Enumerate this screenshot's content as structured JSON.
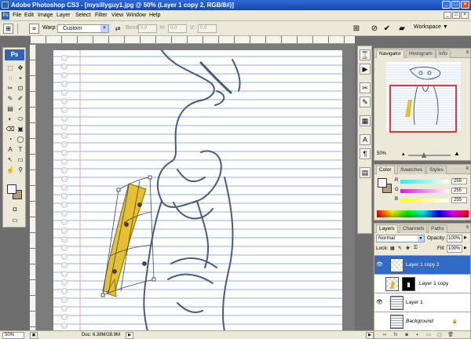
{
  "window": {
    "title": "Adobe Photoshop CS3 - [mysillyguy1.jpg @ 50% (Layer 1 copy 2, RGB/8#)]",
    "controls": [
      "_",
      "□",
      "×"
    ]
  },
  "menu": {
    "items": [
      "File",
      "Edit",
      "Image",
      "Layer",
      "Select",
      "Filter",
      "View",
      "Window",
      "Help"
    ],
    "doc_controls": [
      "_",
      "□",
      "×"
    ]
  },
  "options_bar": {
    "tool_icon": "transform-icon",
    "warp_label": "Warp:",
    "warp_value": "Custom",
    "bend_label": "Bend:",
    "bend_value": "0.0",
    "h_label": "H:",
    "h_value": "0.0",
    "v_label": "V:",
    "v_value": "0.0",
    "workspace_label": "Workspace ▼"
  },
  "toolbox": {
    "logo": "Ps",
    "tool_glyphs": [
      "⬚",
      "✥",
      "◌",
      "⌖",
      "✂",
      "⊡",
      "✎",
      "✐",
      "▤",
      "✓",
      "◐",
      "⬭",
      "⌫",
      "▣",
      "◔",
      "◯",
      "A",
      "T",
      "↖",
      "▭",
      "☝",
      "⚲"
    ],
    "fg_color": "#ffffff",
    "bg_color": "#b49a7a"
  },
  "navigator": {
    "tabs": [
      "Navigator",
      "Histogram",
      "Info"
    ],
    "zoom_value": "50%",
    "view_box_color": "#d83c3c"
  },
  "color_panel": {
    "tabs": [
      "Color",
      "Swatches",
      "Styles"
    ],
    "channels": [
      {
        "label": "R",
        "value": "255",
        "color": "#ff0000"
      },
      {
        "label": "G",
        "value": "255",
        "color": "#ff00ff"
      },
      {
        "label": "B",
        "value": "255",
        "color": "#ffff00"
      }
    ]
  },
  "layers_panel": {
    "tabs": [
      "Layers",
      "Channels",
      "Paths"
    ],
    "blend_mode": "Normal",
    "opacity_label": "Opacity:",
    "opacity_value": "100%",
    "lock_label": "Lock:",
    "fill_label": "Fill:",
    "fill_value": "100%",
    "layers": [
      {
        "name": "Layer 1 copy 2",
        "selected": true,
        "visible": true
      },
      {
        "name": "Layer 1 copy",
        "selected": false,
        "visible": false
      },
      {
        "name": "Layer 1",
        "selected": false,
        "visible": true
      },
      {
        "name": "Background",
        "selected": false,
        "visible": false,
        "locked": true
      }
    ],
    "footer_icons": [
      "link-icon",
      "fx-icon",
      "mask-icon",
      "adjustment-icon",
      "folder-icon",
      "new-layer-icon",
      "trash-icon"
    ]
  },
  "status": {
    "zoom": "50%",
    "doc_size": "Doc: 6.38M/28.9M"
  },
  "colors": {
    "accent": "#316ac5",
    "paint": "#e6c030"
  }
}
